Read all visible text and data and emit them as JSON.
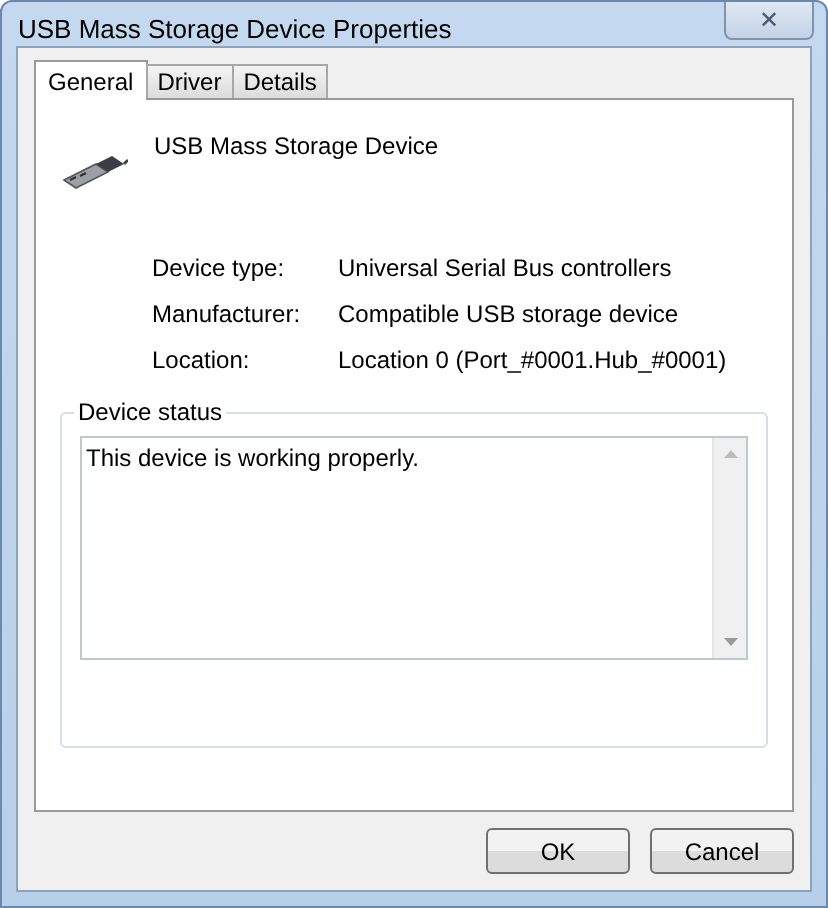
{
  "window": {
    "title": "USB Mass Storage Device Properties",
    "close": "✕"
  },
  "tabs": [
    {
      "label": "General",
      "selected": true
    },
    {
      "label": "Driver",
      "selected": false
    },
    {
      "label": "Details",
      "selected": false
    }
  ],
  "device_name": "USB Mass Storage Device",
  "properties": [
    {
      "label": "Device type:",
      "value": "Universal Serial Bus controllers"
    },
    {
      "label": "Manufacturer:",
      "value": "Compatible USB storage device"
    },
    {
      "label": "Location:",
      "value": "Location 0 (Port_#0001.Hub_#0001)"
    }
  ],
  "device_status": {
    "title": "Device status",
    "text": "This device is working properly."
  },
  "buttons": [
    "OK",
    "Cancel"
  ]
}
